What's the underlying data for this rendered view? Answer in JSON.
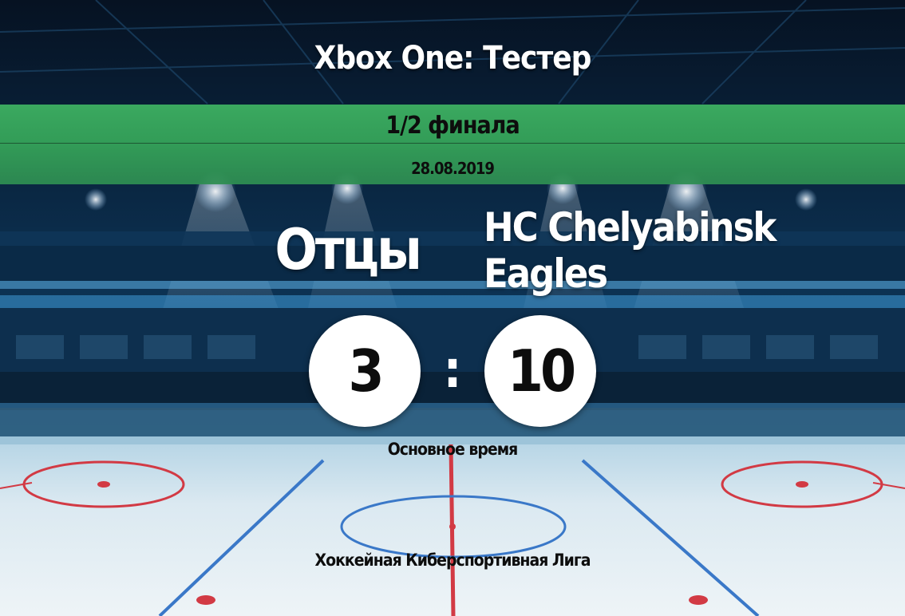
{
  "header": {
    "title": "Xbox One: Тестер",
    "stage": "1/2 финала",
    "date": "28.08.2019"
  },
  "match": {
    "home_team": "Отцы",
    "away_team_line1": "HC Chelyabinsk",
    "away_team_line2": "Eagles",
    "home_score": "3",
    "away_score": "10",
    "separator": ":",
    "period": "Основное время"
  },
  "footer": {
    "league": "Хоккейная Киберспортивная Лига"
  },
  "colors": {
    "band": "#36a75a",
    "ice": "#dcebf2",
    "arena": "#0a2540",
    "rink_red": "#d23a44",
    "rink_blue": "#3a78c8"
  }
}
